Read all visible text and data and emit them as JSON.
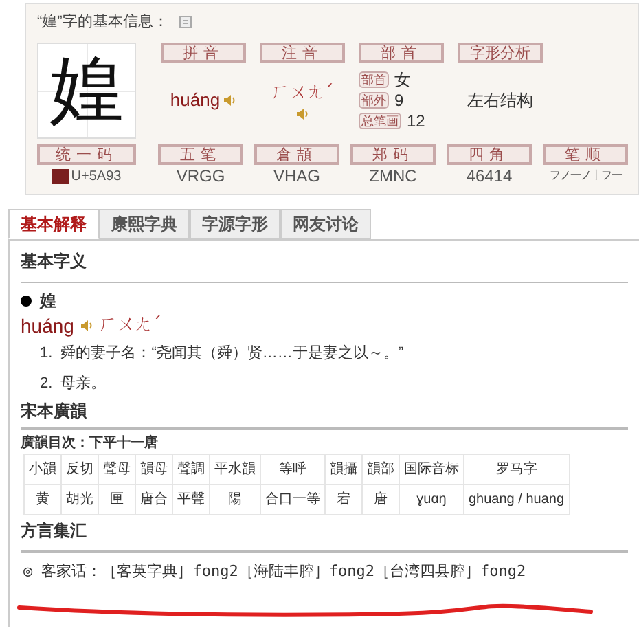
{
  "info": {
    "title": "“媓”字的基本信息：",
    "character": "媓",
    "top_fields": [
      {
        "label": "拼音",
        "kind": "sound",
        "value": "huáng"
      },
      {
        "label": "注音",
        "kind": "sound_below",
        "value": "ㄏㄨㄤˊ"
      },
      {
        "label": "部首",
        "kind": "tagged",
        "rows": [
          {
            "tag": "部首",
            "value": "女"
          },
          {
            "tag": "部外",
            "value": "9"
          },
          {
            "tag": "总笔画",
            "value": "12"
          }
        ]
      },
      {
        "label": "字形分析",
        "kind": "text",
        "value": "左右结构"
      }
    ],
    "bottom_fields": [
      {
        "label": "统一码",
        "kind": "unicode",
        "value": "U+5A93"
      },
      {
        "label": "五笔",
        "kind": "text",
        "value": "VRGG"
      },
      {
        "label": "倉頡",
        "kind": "text",
        "value": "VHAG"
      },
      {
        "label": "郑码",
        "kind": "text",
        "value": "ZMNC"
      },
      {
        "label": "四角",
        "kind": "text",
        "value": "46414"
      },
      {
        "label": "笔顺",
        "kind": "text",
        "value": "フノ一ノ丨フ一"
      }
    ]
  },
  "tabs": [
    {
      "label": "基本解释",
      "selected": true
    },
    {
      "label": "康熙字典",
      "selected": false
    },
    {
      "label": "字源字形",
      "selected": false
    },
    {
      "label": "网友讨论",
      "selected": false
    }
  ],
  "basic": {
    "heading": "基本字义",
    "entry": "媓",
    "pinyin": "huáng",
    "zhuyin": "ㄏㄨㄤˊ",
    "definitions": [
      {
        "number": "1.",
        "text": "舜的妻子名：“尧闻其（舜）贤……于是妻之以～。”"
      },
      {
        "number": "2.",
        "text": "母亲。"
      }
    ]
  },
  "guangyun": {
    "heading": "宋本廣韻",
    "subheading": "廣韻目次：下平十一唐",
    "table": {
      "columns": [
        "小韻",
        "反切",
        "聲母",
        "韻母",
        "聲調",
        "平水韻",
        "等呼",
        "韻攝",
        "韻部",
        "国际音标",
        "罗马字"
      ],
      "rows": [
        [
          "黄",
          "胡光",
          "匣",
          "唐合",
          "平聲",
          "陽",
          "合口一等",
          "宕",
          "唐",
          "ɣuɑŋ",
          "ghuang / huang"
        ]
      ]
    }
  },
  "dialect": {
    "heading": "方言集汇",
    "line": "◎ 客家话：［客英字典］fong2［海陆丰腔］fong2［台湾四县腔］fong2"
  }
}
